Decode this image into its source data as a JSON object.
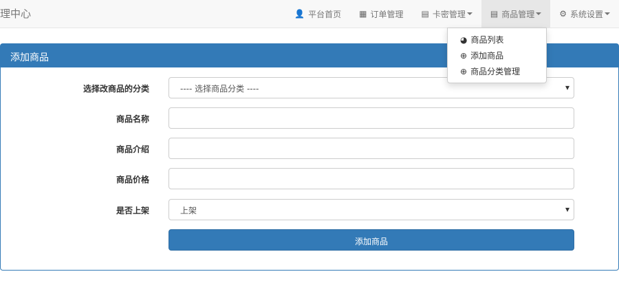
{
  "brand": "理中心",
  "nav": [
    {
      "icon": "user-icon",
      "glyph": "👤",
      "label": "平台首页",
      "caret": false
    },
    {
      "icon": "calendar-icon",
      "glyph": "▦",
      "label": "订单管理",
      "caret": false
    },
    {
      "icon": "list-icon",
      "glyph": "▤",
      "label": "卡密管理",
      "caret": true
    },
    {
      "icon": "list-icon",
      "glyph": "▤",
      "label": "商品管理",
      "caret": true,
      "active": true
    },
    {
      "icon": "gear-icon",
      "glyph": "⚙",
      "label": "系统设置",
      "caret": true
    }
  ],
  "dropdown": [
    {
      "icon": "globe-icon",
      "glyph": "◕",
      "label": "商品列表"
    },
    {
      "icon": "plus-circle-icon",
      "glyph": "⊕",
      "label": "添加商品"
    },
    {
      "icon": "plus-circle-icon",
      "glyph": "⊕",
      "label": "商品分类管理"
    }
  ],
  "panel": {
    "title": "添加商品"
  },
  "form": {
    "category_label": "选择改商品的分类",
    "category_value": "---- 选择商品分类 ----",
    "name_label": "商品名称",
    "name_value": "",
    "intro_label": "商品介绍",
    "intro_value": "",
    "price_label": "商品价格",
    "price_value": "",
    "listed_label": "是否上架",
    "listed_value": "上架",
    "submit": "添加商品"
  }
}
